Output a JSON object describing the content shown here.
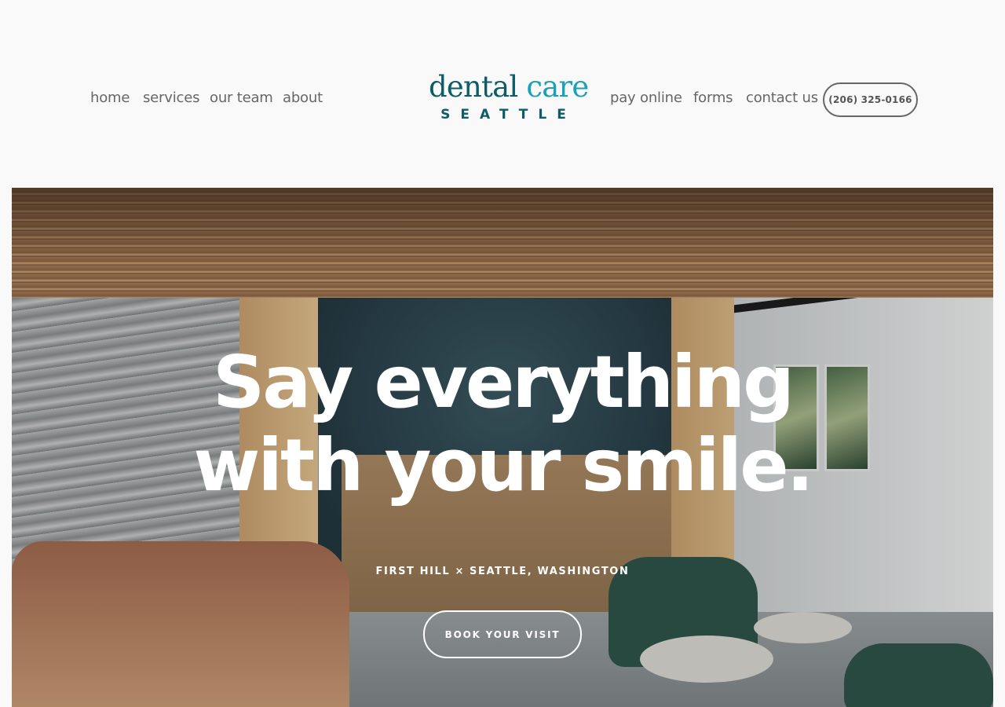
{
  "nav": {
    "left": [
      "home",
      "services",
      "our team",
      "about"
    ],
    "right": [
      "pay online",
      "forms",
      "contact us"
    ],
    "phone": "(206) 325-0166"
  },
  "logo": {
    "word1": "dental",
    "word2": "care",
    "city": "SEATTLE",
    "colors": {
      "primary": "#0d5c66",
      "accent": "#1aa1b8"
    }
  },
  "hero": {
    "headline_line1": "Say everything",
    "headline_line2": "with your smile.",
    "location": "FIRST HILL × SEATTLE, WASHINGTON",
    "cta": "BOOK YOUR VISIT"
  }
}
